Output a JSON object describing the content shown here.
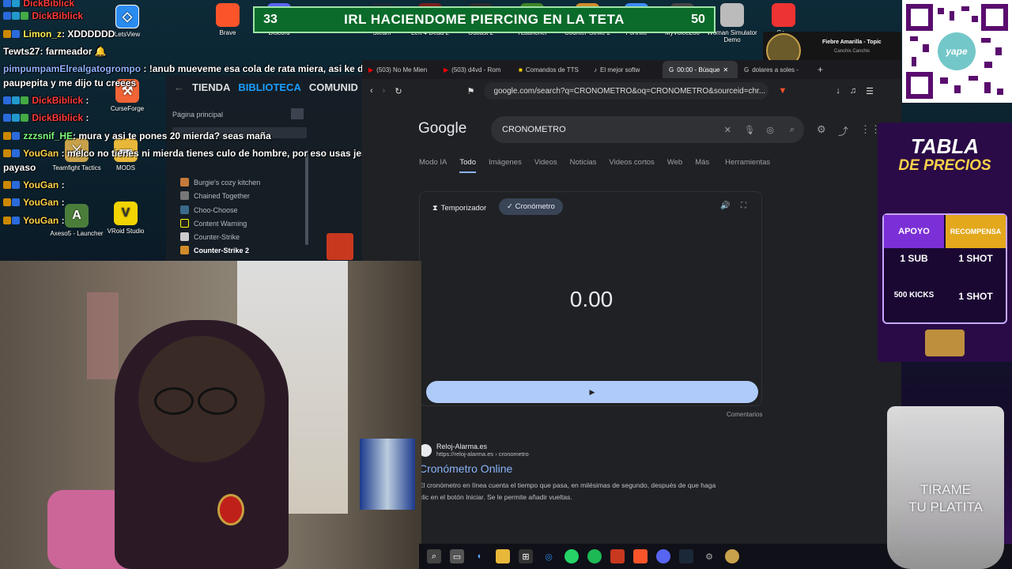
{
  "banner": {
    "left_num": "33",
    "text": "IRL HACIENDOME PIERCING EN LA TETA",
    "right_num": "50"
  },
  "desktop_icons_top": [
    {
      "label": "Brave",
      "color": "#fb542b"
    },
    {
      "label": "Discord",
      "color": "#5865f2"
    },
    {
      "label": "Steam",
      "color": "#1b2838"
    },
    {
      "label": "Left 4 Dead 2",
      "color": "#7a1f1f"
    },
    {
      "label": "Outlast 2",
      "color": "#2b2b2b"
    },
    {
      "label": "TLauncher",
      "color": "#3c8527"
    },
    {
      "label": "Counter-Strike 2",
      "color": "#d18b2a"
    },
    {
      "label": "Fortnite",
      "color": "#3b8cf5"
    },
    {
      "label": "MyVoiceZoo",
      "color": "#444"
    },
    {
      "label": "Woman Simulator Demo",
      "color": "#bbb"
    },
    {
      "label": "Ge...",
      "color": "#e33"
    }
  ],
  "desktop_icons_left": [
    {
      "label": "LetsView",
      "color": "#2b8cf0"
    },
    {
      "label": "CurseForge",
      "color": "#f16436"
    },
    {
      "label": "Teamfight Tactics",
      "color": "#c8a24a"
    },
    {
      "label": "MODS",
      "color": "#e8b83a"
    },
    {
      "label": "Axeso5 - Launcher",
      "color": "#4b7d3a"
    },
    {
      "label": "VRoid Studio",
      "color": "#f2d400"
    }
  ],
  "music": {
    "title": "Fiebre Amarilla - Topic",
    "subtitle": "Canchis Canchis"
  },
  "chat": [
    {
      "user": "DickBiblick",
      "msg": "",
      "color": "#ff3b3b"
    },
    {
      "user": "Limon_z",
      "msg": ": XDDDDDD",
      "color": "#ffee55"
    },
    {
      "user": "Tewts27",
      "msg": ": farmeador 🔔",
      "color": "#ffffff"
    },
    {
      "user": "pimpumpamElrealgatogrompo",
      "msg": ": !anub mueveme esa cola de rata miera, asi ke dije a",
      "color": "#8fb3ff"
    },
    {
      "user": "",
      "msg": "paupepita y me dijo tu creees",
      "color": "#ffffff"
    },
    {
      "user": "DickBiblick",
      "msg": ":",
      "color": "#ff3b3b"
    },
    {
      "user": "DickBiblick",
      "msg": ":",
      "color": "#ff3b3b"
    },
    {
      "user": "zzzsnif_HE",
      "msg": ": mura y asi te pones 20 mierda? seas maña",
      "color": "#7cff7c"
    },
    {
      "user": "YouGan",
      "msg": ": melco no tienes ni mierda tienes culo de hombre, por eso usas jens de",
      "color": "#ffd24a"
    },
    {
      "user": "",
      "msg": "payaso",
      "color": "#ffffff"
    },
    {
      "user": "YouGan",
      "msg": ":",
      "color": "#ffd24a"
    },
    {
      "user": "YouGan",
      "msg": ":",
      "color": "#ffd24a"
    },
    {
      "user": "YouGan",
      "msg": ":",
      "color": "#ffd24a"
    }
  ],
  "steam": {
    "tabs": [
      "TIENDA",
      "BIBLIOTECA",
      "COMUNID"
    ],
    "home": "Página principal",
    "games": [
      "Burgie's cozy kitchen",
      "Chained Together",
      "Choo-Choose",
      "Content Warning",
      "Counter-Strike",
      "Counter-Strike 2"
    ]
  },
  "browser": {
    "tabs": [
      "(503) No Me Mien",
      "(503) d4vd - Rom",
      "Comandos de TTS",
      "El mejor softw",
      "00:00 - Búsque",
      "dolares a soles -"
    ],
    "url": "google.com/search?q=CRONOMETRO&oq=CRONOMETRO&sourceid=chr..."
  },
  "google": {
    "logo": "Google",
    "query": "CRONOMETRO",
    "nav": [
      "Modo IA",
      "Todo",
      "Imágenes",
      "Videos",
      "Noticias",
      "Videos cortos",
      "Web",
      "Más",
      "Herramientas"
    ],
    "timer_tab": "Temporizador",
    "stopwatch_tab": "Cronómetro",
    "time": "0.00",
    "comments": "Comentarios",
    "result_site": "Reloj-Alarma.es",
    "result_url": "https://reloj-alarma.es › cronometro",
    "result_title": "Cronómetro Online",
    "result_snippet_1": "El cronómetro en línea cuenta el tiempo que pasa, en milésimas de segundo, después de que haga",
    "result_snippet_2": "clic en el botón Iniciar. Se le permite añadir vueltas."
  },
  "qr": {
    "brand": "yape"
  },
  "prices": {
    "title_1": "TABLA",
    "title_2": "DE PRECIOS",
    "head_left": "APOYO",
    "head_right": "RECOMPENSA",
    "rows": [
      {
        "left": "1 SUB",
        "right": "1 SHOT"
      },
      {
        "left": "500 KICKS",
        "right": "1 SHOT"
      }
    ]
  },
  "glass": {
    "line1": "TIRAME",
    "line2": "TU PLATITA"
  },
  "colors": {
    "accent": "#8ab4f8",
    "banner": "#0b6b2a",
    "steam_active": "#1a9fff",
    "prices_bg": "#2a0b47"
  }
}
